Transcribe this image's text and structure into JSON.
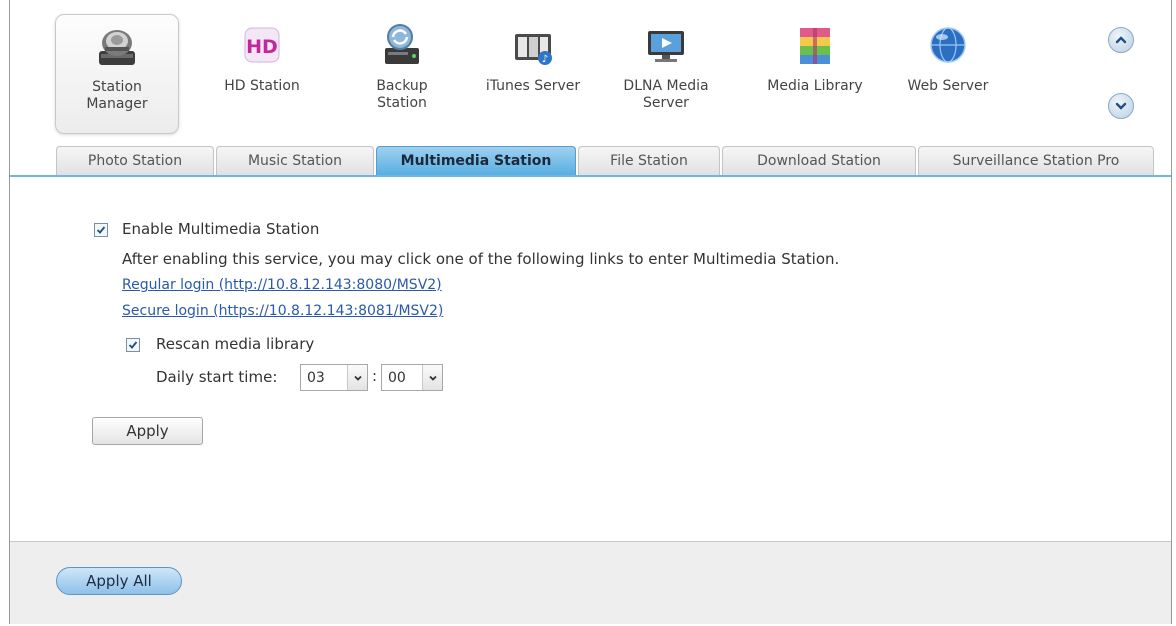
{
  "apps": [
    {
      "label_line1": "Station",
      "label_line2": "Manager",
      "icon": "station-manager-icon"
    },
    {
      "label_line1": "HD Station",
      "label_line2": "",
      "icon": "hd-station-icon"
    },
    {
      "label_line1": "Backup",
      "label_line2": "Station",
      "icon": "backup-station-icon"
    },
    {
      "label_line1": "iTunes Server",
      "label_line2": "",
      "icon": "itunes-server-icon"
    },
    {
      "label_line1": "DLNA Media",
      "label_line2": "Server",
      "icon": "dlna-media-server-icon"
    },
    {
      "label_line1": "Media Library",
      "label_line2": "",
      "icon": "media-library-icon"
    },
    {
      "label_line1": "Web Server",
      "label_line2": "",
      "icon": "web-server-icon"
    }
  ],
  "tabs": [
    {
      "label": "Photo Station"
    },
    {
      "label": "Music Station"
    },
    {
      "label": "Multimedia Station"
    },
    {
      "label": "File Station"
    },
    {
      "label": "Download Station"
    },
    {
      "label": "Surveillance Station Pro"
    }
  ],
  "active_tab": "Multimedia Station",
  "content": {
    "enable_label": "Enable Multimedia Station",
    "enable_checked": true,
    "description": "After enabling this service, you may click one of the following links to enter Multimedia Station.",
    "regular_login": "Regular login (http://10.8.12.143:8080/MSV2)",
    "secure_login": "Secure login (https://10.8.12.143:8081/MSV2)",
    "rescan_label": "Rescan media library",
    "rescan_checked": true,
    "daily_start_label": "Daily start time:",
    "hour_value": "03",
    "time_separator": ":",
    "minute_value": "00",
    "apply_label": "Apply"
  },
  "footer": {
    "apply_all_label": "Apply All"
  },
  "colors": {
    "active_tab": "#58aee2",
    "link": "#2a5aa8",
    "footer_bg": "#eeeeee"
  }
}
